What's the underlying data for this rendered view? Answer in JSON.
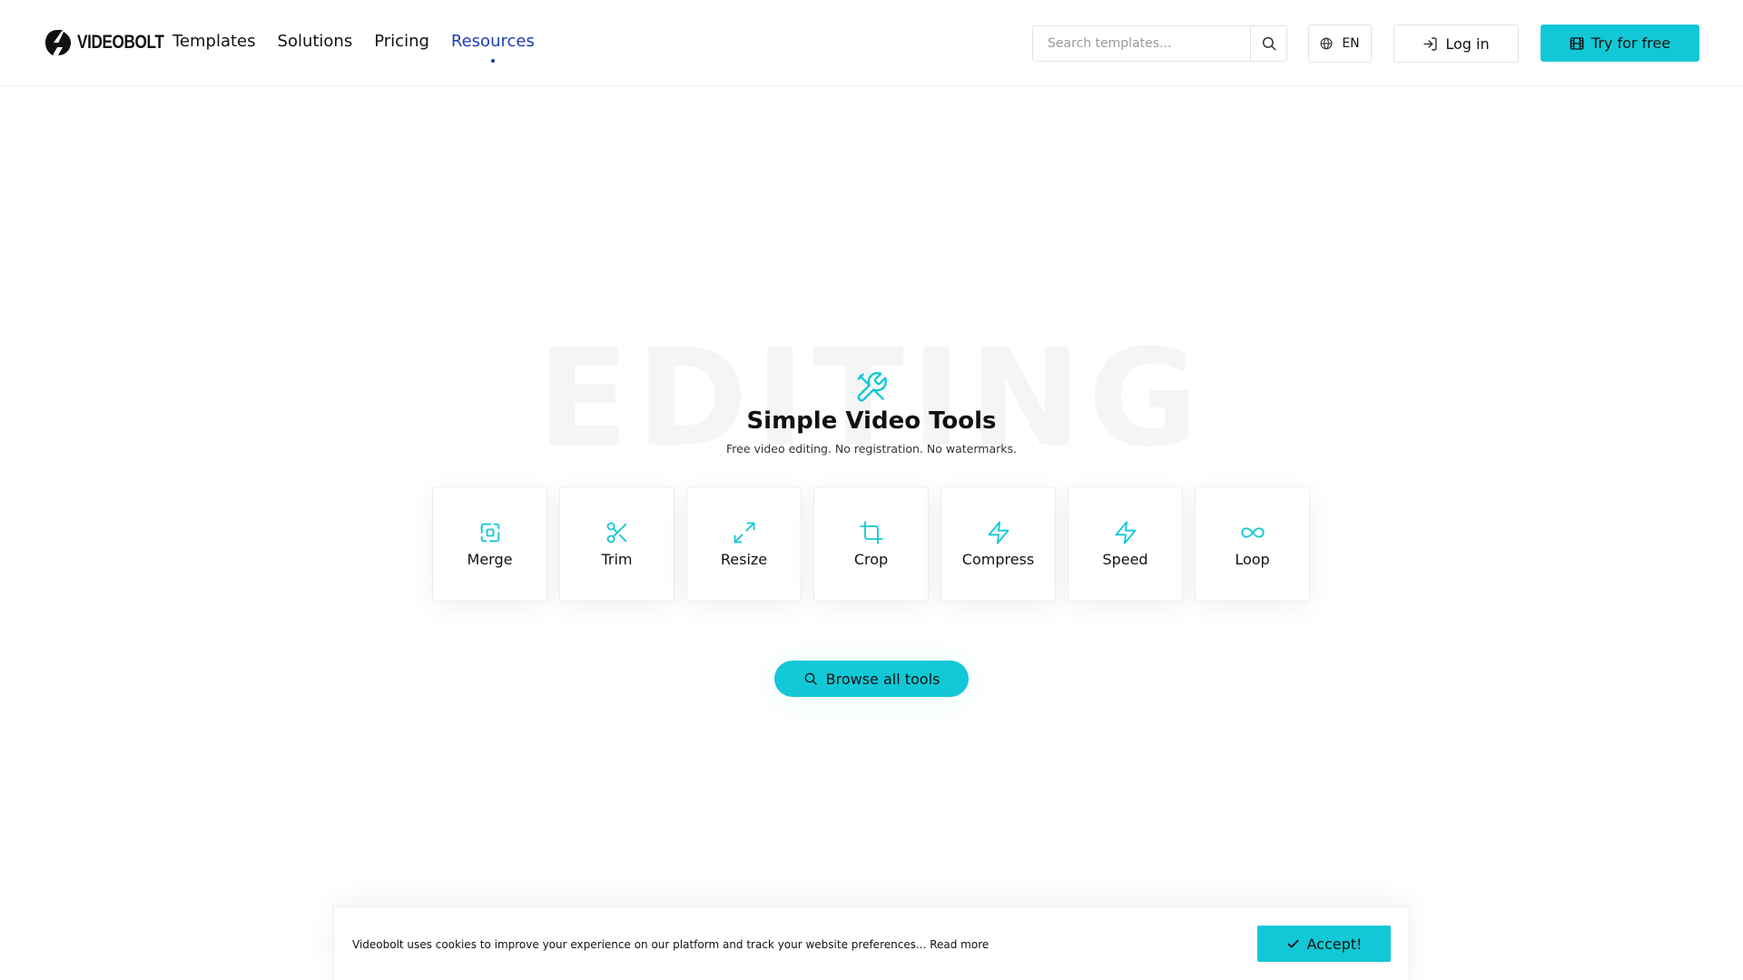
{
  "brand": {
    "name": "VIDEOBOLT",
    "accent": "#12c8d6",
    "nav_active": "#1e3db3"
  },
  "nav": {
    "items": [
      {
        "label": "Templates",
        "active": false
      },
      {
        "label": "Solutions",
        "active": false
      },
      {
        "label": "Pricing",
        "active": false
      },
      {
        "label": "Resources",
        "active": true
      }
    ]
  },
  "search": {
    "placeholder": "Search templates...",
    "value": "",
    "icon": "search-icon"
  },
  "language": {
    "label": "EN",
    "icon": "globe-icon"
  },
  "login": {
    "label": "Log in",
    "icon": "login-icon"
  },
  "cta": {
    "label": "Try for free",
    "icon": "film-icon"
  },
  "hero": {
    "background_word": "EDITING",
    "icon": "tools-icon",
    "title": "Simple Video Tools",
    "subtitle": "Free video editing. No registration. No watermarks."
  },
  "tools": [
    {
      "label": "Merge",
      "icon": "merge-icon"
    },
    {
      "label": "Trim",
      "icon": "scissors-icon"
    },
    {
      "label": "Resize",
      "icon": "resize-icon"
    },
    {
      "label": "Crop",
      "icon": "crop-icon"
    },
    {
      "label": "Compress",
      "icon": "bolt-icon"
    },
    {
      "label": "Speed",
      "icon": "bolt-icon"
    },
    {
      "label": "Loop",
      "icon": "infinity-icon"
    }
  ],
  "browse": {
    "label": "Browse all tools",
    "icon": "search-icon"
  },
  "cookie": {
    "text": "Videobolt uses cookies to improve your experience on our platform and track your website preferences... Read more",
    "accept_label": "Accept!",
    "icon": "check-icon"
  }
}
